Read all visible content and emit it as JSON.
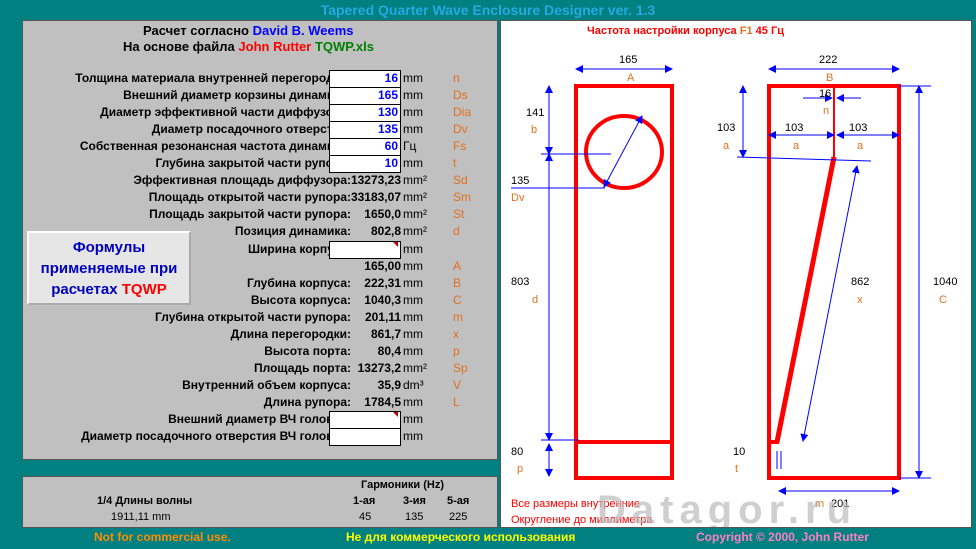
{
  "title": "Tapered Quarter Wave Enclosure Designer ver. 1.3",
  "header": {
    "line1_prefix": "Расчет согласно",
    "line1_name": "David B. Weems",
    "line2_prefix": "На основе файла",
    "line2_name": "John Rutter",
    "line2_file": "TQWP.xls"
  },
  "rows": [
    {
      "label": "Толщина материала внутренней перегородки:",
      "value": "16",
      "unit": "mm",
      "sym": "n",
      "input": true
    },
    {
      "label": "Внешний диаметр корзины динамика:",
      "value": "165",
      "unit": "mm",
      "sym": "Ds",
      "input": true
    },
    {
      "label": "Диаметр эффективной части диффузора:",
      "value": "130",
      "unit": "mm",
      "sym": "Dia",
      "input": true
    },
    {
      "label": "Диаметр посадочного отверстия:",
      "value": "135",
      "unit": "mm",
      "sym": "Dv",
      "input": true
    },
    {
      "label": "Собственная резонансная частота динамика:",
      "value": "60",
      "unit": "Гц",
      "sym": "Fs",
      "input": true
    },
    {
      "label": "Глубина закрытой части рупора:",
      "value": "10",
      "unit": "mm",
      "sym": "t",
      "input": true
    },
    {
      "label": "Эффективная площадь диффузора:",
      "value": "13273,23",
      "unit": "mm²",
      "sym": "Sd",
      "input": false
    },
    {
      "label": "Площадь открытой части рупора:",
      "value": "33183,07",
      "unit": "mm²",
      "sym": "Sm",
      "input": false
    },
    {
      "label": "Площадь закрытой части рупора:",
      "value": "1650,0",
      "unit": "mm²",
      "sym": "St",
      "input": false
    },
    {
      "label": "Позиция динамика:",
      "value": "802,8",
      "unit": "mm²",
      "sym": "d",
      "input": false
    },
    {
      "label": "Ширина корпуса:",
      "value": "",
      "unit": "mm",
      "sym": "",
      "input": true
    },
    {
      "label": "",
      "value": "165,00",
      "unit": "mm",
      "sym": "A",
      "input": false
    },
    {
      "label": "Глубина корпуса:",
      "value": "222,31",
      "unit": "mm",
      "sym": "B",
      "input": false
    },
    {
      "label": "Высота корпуса:",
      "value": "1040,3",
      "unit": "mm",
      "sym": "C",
      "input": false
    },
    {
      "label": "Глубина открытой части рупора:",
      "value": "201,11",
      "unit": "mm",
      "sym": "m",
      "input": false
    },
    {
      "label": "Длина перегородки:",
      "value": "861,7",
      "unit": "mm",
      "sym": "x",
      "input": false
    },
    {
      "label": "Высота порта:",
      "value": "80,4",
      "unit": "mm",
      "sym": "p",
      "input": false
    },
    {
      "label": "Площадь порта:",
      "value": "13273,2",
      "unit": "mm²",
      "sym": "Sp",
      "input": false
    },
    {
      "label": "Внутренний объем корпуса:",
      "value": "35,9",
      "unit": "dm³",
      "sym": "V",
      "input": false
    },
    {
      "label": "Длина рупора:",
      "value": "1784,5",
      "unit": "mm",
      "sym": "L",
      "input": false
    },
    {
      "label": "Внешний диаметр ВЧ головки:",
      "value": "",
      "unit": "mm",
      "sym": "",
      "input": true
    },
    {
      "label": "Диаметр посадочного отверстия ВЧ головки:",
      "value": "",
      "unit": "mm",
      "sym": "",
      "input": true
    }
  ],
  "formula_button": {
    "line1": "Формулы",
    "line2": "применяемые при",
    "line3": "расчетах",
    "accent": "TQWP"
  },
  "harmonics": {
    "title": "Гармоники (Hz)",
    "wave_label": "1/4 Длины волны",
    "wave_value": "1911,11 mm",
    "cols": [
      "1-ая",
      "3-ия",
      "5-ая"
    ],
    "values": [
      "45",
      "135",
      "225"
    ]
  },
  "footer": {
    "left": "Not for commercial use.",
    "center": "Не для коммерческого использования",
    "right": "Copyright © 2000, John Rutter"
  },
  "drawing": {
    "tuning_label": "Частота настройки корпуса",
    "tuning_f": "F1",
    "tuning_value": "45",
    "tuning_unit": "Гц",
    "note1": "Все размеры внутренние",
    "note2": "Округление до миллиметра",
    "watermark": "Datagor.ru",
    "dims": {
      "A": "165",
      "A_sym": "A",
      "B": "222",
      "B_sym": "B",
      "b": "141",
      "b_sym": "b",
      "Dv": "135",
      "Dv_sym": "Dv",
      "d": "803",
      "d_sym": "d",
      "p": "80",
      "p_sym": "p",
      "n": "16",
      "n_sym": "n",
      "a_left": "103",
      "a_sym": "a",
      "a_mid": "103",
      "a_right": "103",
      "x": "862",
      "x_sym": "x",
      "C": "1040",
      "C_sym": "C",
      "t": "10",
      "t_sym": "t",
      "m": "201",
      "m_sym": "m"
    }
  },
  "colors": {
    "background": "#008080",
    "panel": "#c0c0c0",
    "accent_blue": "#27a9e1",
    "red": "#ff0000",
    "orange": "#e07020"
  }
}
